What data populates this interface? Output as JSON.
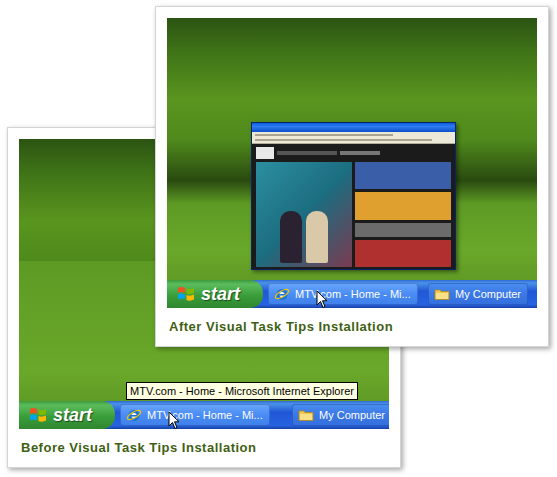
{
  "cards": [
    {
      "caption": "Before Visual Task Tips Installation",
      "start": "start",
      "taskbar_buttons": [
        {
          "label": "MTV.com - Home - Mi...",
          "hovered": true
        },
        {
          "label": "My Computer",
          "hovered": false
        }
      ],
      "tooltip": "MTV.com - Home - Microsoft Internet Explorer",
      "preview": false
    },
    {
      "caption": "After Visual Task Tips Installation",
      "start": "start",
      "taskbar_buttons": [
        {
          "label": "MTV.com - Home - Mi...",
          "hovered": true
        },
        {
          "label": "My Computer",
          "hovered": false
        }
      ],
      "preview": true
    }
  ]
}
